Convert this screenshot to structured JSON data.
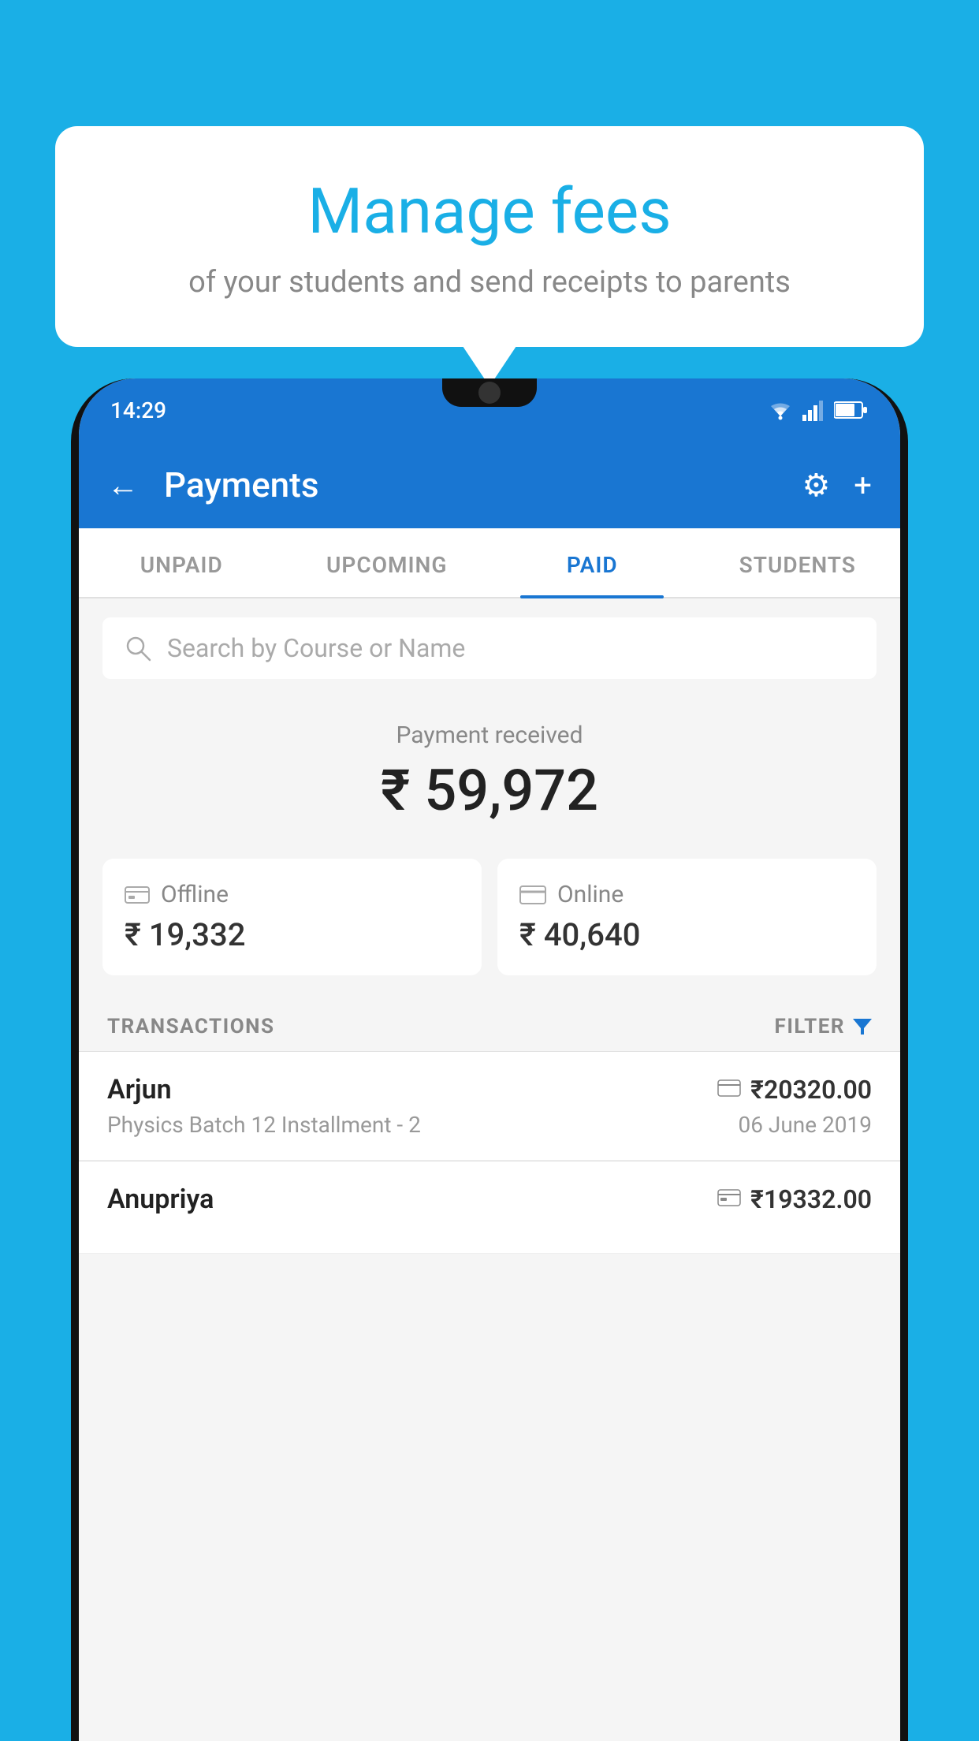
{
  "background_color": "#1AAFE6",
  "speech_bubble": {
    "title": "Manage fees",
    "subtitle": "of your students and send receipts to parents"
  },
  "status_bar": {
    "time": "14:29"
  },
  "app_header": {
    "title": "Payments",
    "back_label": "←",
    "settings_label": "⚙",
    "add_label": "+"
  },
  "tabs": [
    {
      "label": "UNPAID",
      "active": false
    },
    {
      "label": "UPCOMING",
      "active": false
    },
    {
      "label": "PAID",
      "active": true
    },
    {
      "label": "STUDENTS",
      "active": false
    }
  ],
  "search": {
    "placeholder": "Search by Course or Name"
  },
  "payment_summary": {
    "label": "Payment received",
    "amount": "₹ 59,972",
    "offline_label": "Offline",
    "offline_amount": "₹ 19,332",
    "online_label": "Online",
    "online_amount": "₹ 40,640"
  },
  "transactions_section": {
    "label": "TRANSACTIONS",
    "filter_label": "FILTER"
  },
  "transactions": [
    {
      "name": "Arjun",
      "amount": "₹20320.00",
      "course": "Physics Batch 12 Installment - 2",
      "date": "06 June 2019",
      "payment_type": "online"
    },
    {
      "name": "Anupriya",
      "amount": "₹19332.00",
      "course": "",
      "date": "",
      "payment_type": "offline"
    }
  ]
}
